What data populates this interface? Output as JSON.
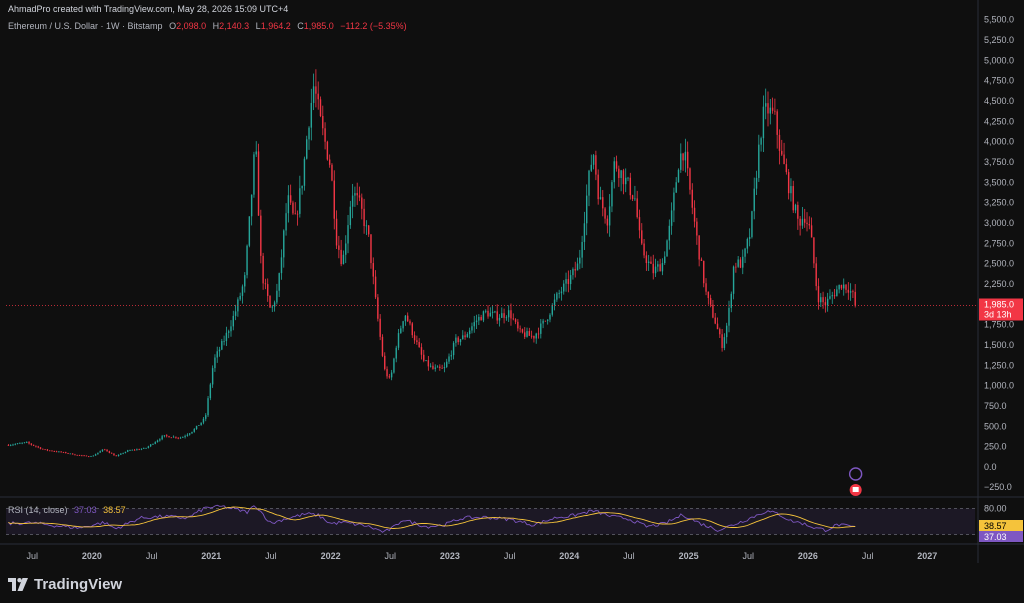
{
  "header": {
    "attribution": "AhmadPro created with TradingView.com, May 28, 2026 15:09 UTC+4"
  },
  "legend": {
    "symbol": "Ethereum / U.S. Dollar · 1W · Bitstamp",
    "open_label": "O",
    "open": "2,098.0",
    "high_label": "H",
    "high": "2,140.3",
    "low_label": "L",
    "low": "1,964.2",
    "close_label": "C",
    "close": "1,985.0",
    "change": "−112.2 (−5.35%)"
  },
  "price_tag": {
    "value": "1,985.0",
    "countdown": "3d 13h"
  },
  "rsi": {
    "label": "RSI (14, close)",
    "value": "37.03",
    "ma_value": "38.57",
    "levels": [
      "80.00",
      "20.00"
    ]
  },
  "brand": {
    "name": "TradingView"
  },
  "colors": {
    "up": "#26a69a",
    "down": "#f23645",
    "rsi": "#7e57c2",
    "rsi_ma": "#f5c33b",
    "background": "#0f0f0f"
  },
  "chart_data": {
    "type": "candlestick",
    "title": "Ethereum / U.S. Dollar · 1W · Bitstamp",
    "y_ticks": [
      "5,500.0",
      "5,250.0",
      "5,000.0",
      "4,750.0",
      "4,500.0",
      "4,250.0",
      "4,000.0",
      "3,750.0",
      "3,500.0",
      "3,250.0",
      "3,000.0",
      "2,750.0",
      "2,500.0",
      "2,250.0",
      "2,000.0",
      "1,750.0",
      "1,500.0",
      "1,250.0",
      "1,000.0",
      "750.0",
      "500.0",
      "250.0",
      "0.0",
      "−250.0"
    ],
    "y_tick_values": [
      5500,
      5250,
      5000,
      4750,
      4500,
      4250,
      4000,
      3750,
      3500,
      3250,
      3000,
      2750,
      2500,
      2250,
      2000,
      1750,
      1500,
      1250,
      1000,
      750,
      500,
      250,
      0,
      -250
    ],
    "x_ticks": [
      "Jul",
      "2020",
      "Jul",
      "2021",
      "Jul",
      "2022",
      "Jul",
      "2023",
      "Jul",
      "2024",
      "Jul",
      "2025",
      "Jul",
      "2026",
      "Jul",
      "2027"
    ],
    "x_tick_dates": [
      2019.5,
      2020,
      2020.5,
      2021,
      2021.5,
      2022,
      2022.5,
      2023,
      2023.5,
      2024,
      2024.5,
      2025,
      2025.5,
      2026,
      2026.5,
      2027
    ],
    "ylim": [
      -370,
      5570
    ],
    "xlim": [
      2019.28,
      2027.4
    ],
    "last_price": 1985.0,
    "anchors": [
      [
        2019.3,
        270
      ],
      [
        2019.45,
        300
      ],
      [
        2019.6,
        210
      ],
      [
        2019.75,
        180
      ],
      [
        2019.9,
        140
      ],
      [
        2020.0,
        130
      ],
      [
        2020.1,
        220
      ],
      [
        2020.2,
        130
      ],
      [
        2020.3,
        200
      ],
      [
        2020.45,
        230
      ],
      [
        2020.6,
        380
      ],
      [
        2020.75,
        360
      ],
      [
        2020.85,
        450
      ],
      [
        2020.95,
        600
      ],
      [
        2021.02,
        1300
      ],
      [
        2021.12,
        1600
      ],
      [
        2021.2,
        1900
      ],
      [
        2021.28,
        2300
      ],
      [
        2021.33,
        3200
      ],
      [
        2021.37,
        4000
      ],
      [
        2021.42,
        2400
      ],
      [
        2021.5,
        1900
      ],
      [
        2021.56,
        2200
      ],
      [
        2021.64,
        3300
      ],
      [
        2021.7,
        3000
      ],
      [
        2021.76,
        3500
      ],
      [
        2021.82,
        4300
      ],
      [
        2021.86,
        4700
      ],
      [
        2021.92,
        4200
      ],
      [
        2022.0,
        3700
      ],
      [
        2022.05,
        2800
      ],
      [
        2022.1,
        2500
      ],
      [
        2022.18,
        3400
      ],
      [
        2022.25,
        3200
      ],
      [
        2022.32,
        2800
      ],
      [
        2022.38,
        2000
      ],
      [
        2022.45,
        1200
      ],
      [
        2022.5,
        1050
      ],
      [
        2022.55,
        1500
      ],
      [
        2022.62,
        1900
      ],
      [
        2022.7,
        1600
      ],
      [
        2022.78,
        1300
      ],
      [
        2022.86,
        1200
      ],
      [
        2022.95,
        1200
      ],
      [
        2023.05,
        1550
      ],
      [
        2023.12,
        1600
      ],
      [
        2023.22,
        1800
      ],
      [
        2023.3,
        1900
      ],
      [
        2023.4,
        1850
      ],
      [
        2023.5,
        1900
      ],
      [
        2023.58,
        1650
      ],
      [
        2023.7,
        1600
      ],
      [
        2023.8,
        1800
      ],
      [
        2023.9,
        2100
      ],
      [
        2024.0,
        2300
      ],
      [
        2024.08,
        2500
      ],
      [
        2024.16,
        3500
      ],
      [
        2024.2,
        3900
      ],
      [
        2024.25,
        3300
      ],
      [
        2024.32,
        3050
      ],
      [
        2024.38,
        3750
      ],
      [
        2024.48,
        3500
      ],
      [
        2024.55,
        3300
      ],
      [
        2024.6,
        2700
      ],
      [
        2024.7,
        2400
      ],
      [
        2024.78,
        2500
      ],
      [
        2024.85,
        3000
      ],
      [
        2024.92,
        3800
      ],
      [
        2024.96,
        3900
      ],
      [
        2025.02,
        3300
      ],
      [
        2025.08,
        2700
      ],
      [
        2025.15,
        2100
      ],
      [
        2025.22,
        1800
      ],
      [
        2025.28,
        1500
      ],
      [
        2025.33,
        1800
      ],
      [
        2025.38,
        2500
      ],
      [
        2025.45,
        2500
      ],
      [
        2025.52,
        2900
      ],
      [
        2025.58,
        3800
      ],
      [
        2025.62,
        4300
      ],
      [
        2025.66,
        4400
      ],
      [
        2025.72,
        4300
      ],
      [
        2025.78,
        3800
      ],
      [
        2025.85,
        3400
      ],
      [
        2025.92,
        3000
      ],
      [
        2025.97,
        3100
      ],
      [
        2026.02,
        2900
      ],
      [
        2026.08,
        2100
      ],
      [
        2026.14,
        2000
      ],
      [
        2026.2,
        2100
      ],
      [
        2026.28,
        2250
      ],
      [
        2026.34,
        2200
      ],
      [
        2026.38,
        2100
      ],
      [
        2026.41,
        1985
      ]
    ],
    "rsi_anchors": [
      [
        2019.3,
        45
      ],
      [
        2019.5,
        47
      ],
      [
        2019.7,
        40
      ],
      [
        2019.9,
        35
      ],
      [
        2020.1,
        48
      ],
      [
        2020.2,
        33
      ],
      [
        2020.4,
        58
      ],
      [
        2020.6,
        62
      ],
      [
        2020.8,
        58
      ],
      [
        2020.95,
        82
      ],
      [
        2021.1,
        85
      ],
      [
        2021.3,
        72
      ],
      [
        2021.37,
        88
      ],
      [
        2021.5,
        45
      ],
      [
        2021.6,
        55
      ],
      [
        2021.8,
        68
      ],
      [
        2021.9,
        64
      ],
      [
        2022.0,
        45
      ],
      [
        2022.1,
        48
      ],
      [
        2022.3,
        40
      ],
      [
        2022.45,
        25
      ],
      [
        2022.55,
        40
      ],
      [
        2022.6,
        55
      ],
      [
        2022.8,
        38
      ],
      [
        2022.95,
        42
      ],
      [
        2023.1,
        58
      ],
      [
        2023.3,
        60
      ],
      [
        2023.5,
        55
      ],
      [
        2023.7,
        42
      ],
      [
        2023.9,
        60
      ],
      [
        2024.0,
        62
      ],
      [
        2024.2,
        75
      ],
      [
        2024.35,
        62
      ],
      [
        2024.5,
        56
      ],
      [
        2024.65,
        38
      ],
      [
        2024.8,
        45
      ],
      [
        2024.95,
        66
      ],
      [
        2025.1,
        45
      ],
      [
        2025.25,
        30
      ],
      [
        2025.35,
        40
      ],
      [
        2025.5,
        56
      ],
      [
        2025.65,
        74
      ],
      [
        2025.75,
        68
      ],
      [
        2025.85,
        52
      ],
      [
        2025.95,
        46
      ],
      [
        2026.05,
        36
      ],
      [
        2026.15,
        30
      ],
      [
        2026.25,
        43
      ],
      [
        2026.35,
        38
      ],
      [
        2026.41,
        37
      ]
    ]
  }
}
